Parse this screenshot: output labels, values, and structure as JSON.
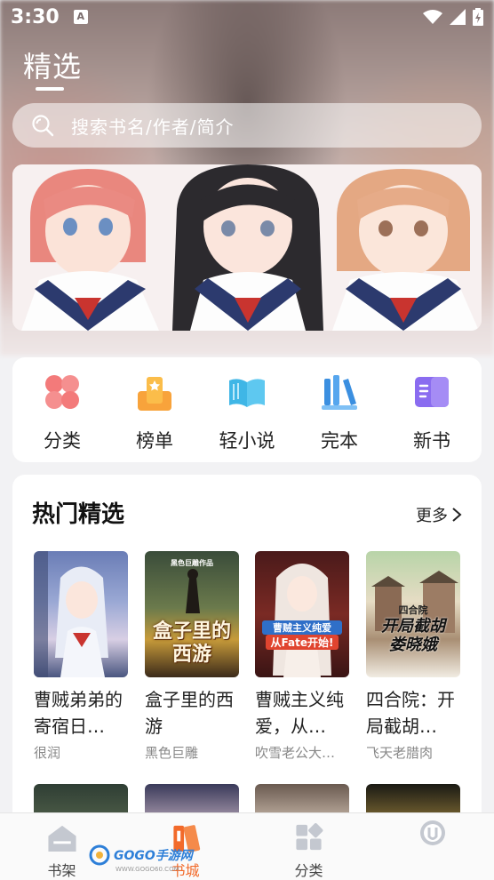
{
  "status": {
    "time": "3:30",
    "badge": "A"
  },
  "header": {
    "title": "精选",
    "search_placeholder": "搜索书名/作者/简介"
  },
  "categories": [
    {
      "label": "分类",
      "icon": "four-petal-icon"
    },
    {
      "label": "榜单",
      "icon": "ranking-icon"
    },
    {
      "label": "轻小说",
      "icon": "open-book-icon"
    },
    {
      "label": "完本",
      "icon": "books-shelf-icon"
    },
    {
      "label": "新书",
      "icon": "new-book-icon"
    }
  ],
  "hot": {
    "title": "热门精选",
    "more": "更多",
    "books": [
      {
        "title": "曹贼弟弟的寄宿日…",
        "author": "很润"
      },
      {
        "title": "盒子里的西游",
        "author": "黑色巨雕",
        "cover_text": "盒子里的西游",
        "cover_top": "黑色巨雕作品"
      },
      {
        "title": "曹贼主义纯爱，从…",
        "author": "吹雪老公大…",
        "cover_text": "曹贼主义纯爱",
        "cover_sub": "从Fate开始!"
      },
      {
        "title": "四合院：开局截胡…",
        "author": "飞天老腊肉",
        "cover_text": "开局截胡娄晓娥",
        "cover_top": "四合院"
      }
    ]
  },
  "nav": [
    {
      "label": "书架",
      "icon": "bookshelf-icon",
      "active": false
    },
    {
      "label": "书城",
      "icon": "bookstore-icon",
      "active": true
    },
    {
      "label": "分类",
      "icon": "category-icon",
      "active": false
    },
    {
      "label": "",
      "icon": "profile-icon",
      "active": false
    }
  ],
  "watermark": {
    "brand": "GOGO手游网",
    "url": "WWW.GOGO60.COM"
  }
}
